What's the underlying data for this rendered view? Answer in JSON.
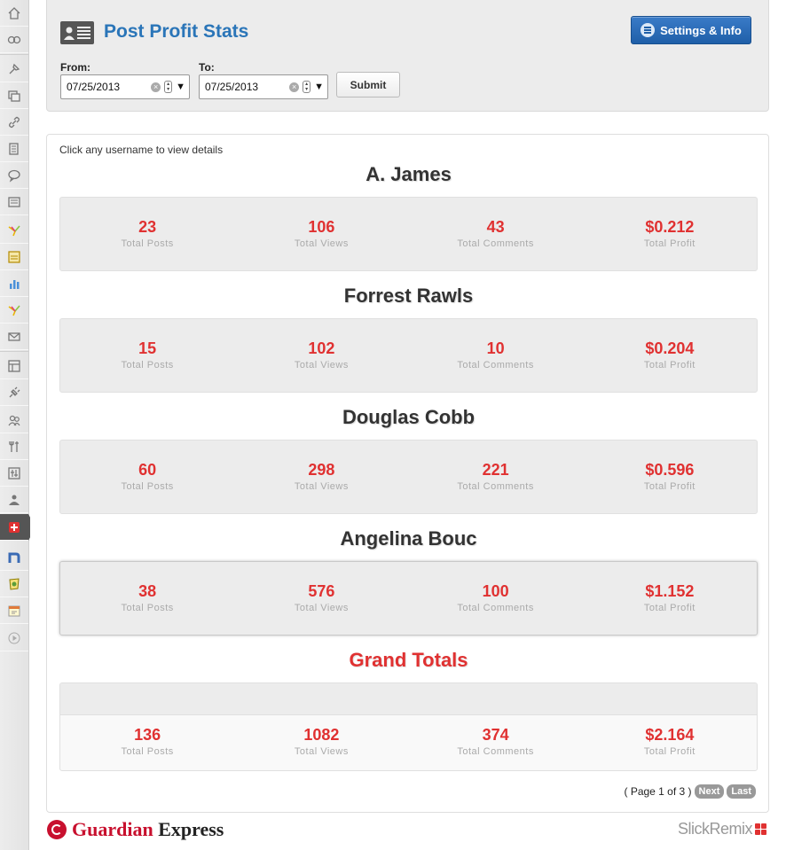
{
  "sidebar": {
    "icons": [
      {
        "name": "dashboard-icon",
        "glyph": "house"
      },
      {
        "name": "jetpack-icon",
        "glyph": "group"
      },
      {
        "name": "posts-icon",
        "glyph": "pin"
      },
      {
        "name": "media-icon",
        "glyph": "media"
      },
      {
        "name": "links-icon",
        "glyph": "link"
      },
      {
        "name": "pages-icon",
        "glyph": "page"
      },
      {
        "name": "comments-icon",
        "glyph": "bubble"
      },
      {
        "name": "feedback-icon",
        "glyph": "list"
      },
      {
        "name": "plugin-star-icon",
        "glyph": "star"
      },
      {
        "name": "portfolio-icon",
        "glyph": "box"
      },
      {
        "name": "stats-icon",
        "glyph": "bars"
      },
      {
        "name": "plugin-star-icon-2",
        "glyph": "star"
      },
      {
        "name": "mail-icon",
        "glyph": "mail"
      },
      {
        "name": "appearance-icon",
        "glyph": "layout"
      },
      {
        "name": "plugins-icon",
        "glyph": "plug"
      },
      {
        "name": "users-icon",
        "glyph": "users"
      },
      {
        "name": "tools-icon",
        "glyph": "tools"
      },
      {
        "name": "settings-icon",
        "glyph": "sliders"
      },
      {
        "name": "seo-icon",
        "glyph": "person"
      },
      {
        "name": "post-profit-icon",
        "glyph": "cross"
      },
      {
        "name": "n-plugin-icon",
        "glyph": "n"
      },
      {
        "name": "badge-icon",
        "glyph": "badge"
      },
      {
        "name": "calendar-icon",
        "glyph": "calendar"
      },
      {
        "name": "collapse-menu-icon",
        "glyph": "play"
      }
    ]
  },
  "header": {
    "title": "Post Profit Stats",
    "settings_label": "Settings & Info",
    "from_label": "From:",
    "from_value": "07/25/2013",
    "to_label": "To:",
    "to_value": "07/25/2013",
    "submit_label": "Submit"
  },
  "content": {
    "hint": "Click any username to view details",
    "users": [
      {
        "name": "A. James",
        "posts": "23",
        "views": "106",
        "comments": "43",
        "profit": "$0.212"
      },
      {
        "name": "Forrest Rawls",
        "posts": "15",
        "views": "102",
        "comments": "10",
        "profit": "$0.204"
      },
      {
        "name": "Douglas Cobb",
        "posts": "60",
        "views": "298",
        "comments": "221",
        "profit": "$0.596"
      },
      {
        "name": "Angelina Bouc",
        "posts": "38",
        "views": "576",
        "comments": "100",
        "profit": "$1.152"
      }
    ],
    "labels": {
      "posts": "Total Posts",
      "views": "Total Views",
      "comments": "Total Comments",
      "profit": "Total Profit"
    },
    "grand_title": "Grand Totals",
    "grand": {
      "posts": "136",
      "views": "1082",
      "comments": "374",
      "profit": "$2.164"
    },
    "pager": {
      "text": "( Page 1 of 3 )",
      "next": "Next",
      "last": "Last"
    }
  },
  "footer": {
    "brand_left_a": "Guardian",
    "brand_left_b": "Express",
    "brand_right": "SlickRemix"
  },
  "colors": {
    "title_blue": "#2a75b8",
    "stat_red": "#e03131",
    "button_blue": "#1f5fa8"
  }
}
